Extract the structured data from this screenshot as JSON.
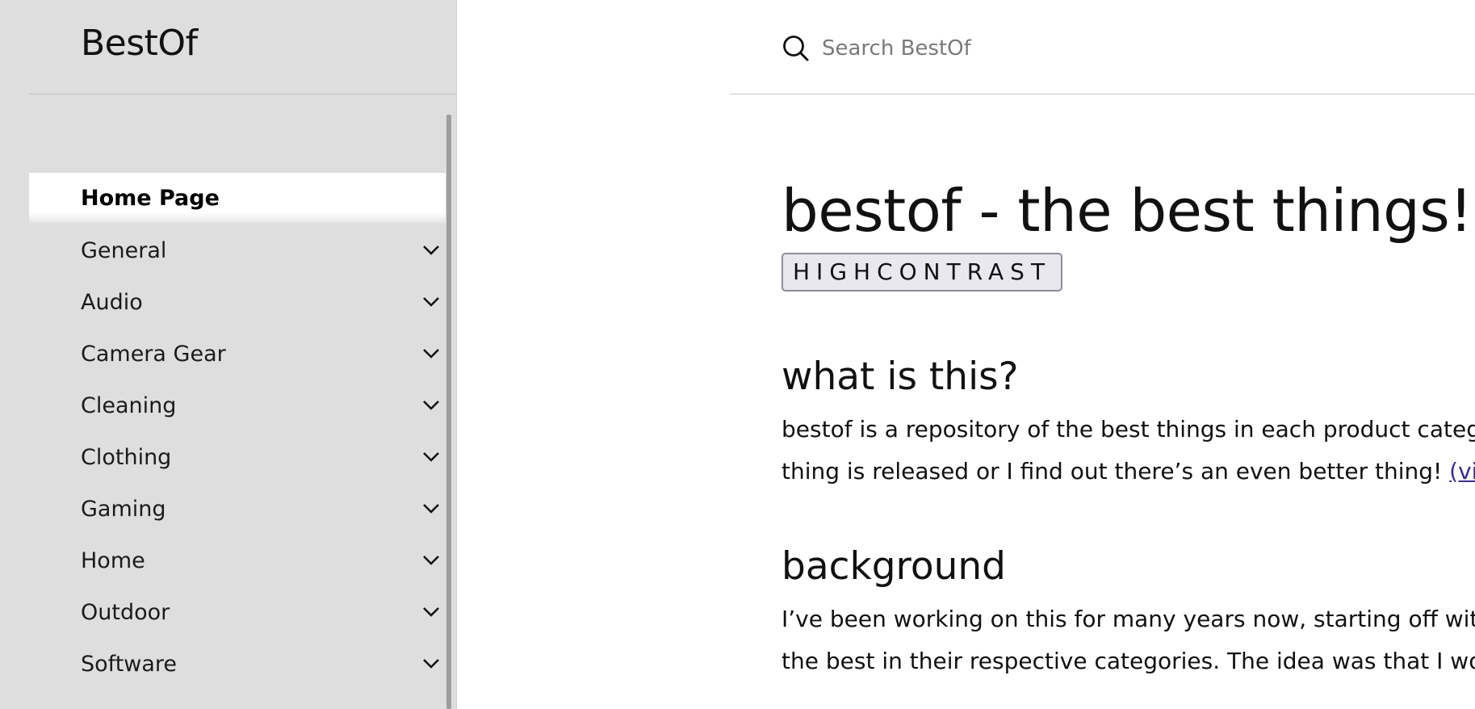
{
  "sidebar": {
    "brand": "BestOf",
    "home": "Home Page",
    "items": [
      {
        "label": "General"
      },
      {
        "label": "Audio"
      },
      {
        "label": "Camera Gear"
      },
      {
        "label": "Cleaning"
      },
      {
        "label": "Clothing"
      },
      {
        "label": "Gaming"
      },
      {
        "label": "Home"
      },
      {
        "label": "Outdoor"
      },
      {
        "label": "Software"
      }
    ],
    "expand_icon": "chevron-down-icon"
  },
  "search": {
    "placeholder": "Search BestOf",
    "icon": "search-icon"
  },
  "main": {
    "title": "bestof - the best things!",
    "contrast_button": "HIGHCONTRAST",
    "sections": [
      {
        "heading": "what is this?",
        "line1": "bestof is a repository of the best things in each product categ",
        "line2": "thing is released or I find out there’s an even better thing! ",
        "link": "(vi"
      },
      {
        "heading": "background",
        "line1": "I’ve been working on this for many years now, starting off wit",
        "line2": "the best in their respective categories. The idea was that I wo"
      }
    ]
  },
  "colors": {
    "sidebar_bg": "#dedede",
    "link": "#3b2b9a",
    "button_bg": "#e9e8ef"
  }
}
